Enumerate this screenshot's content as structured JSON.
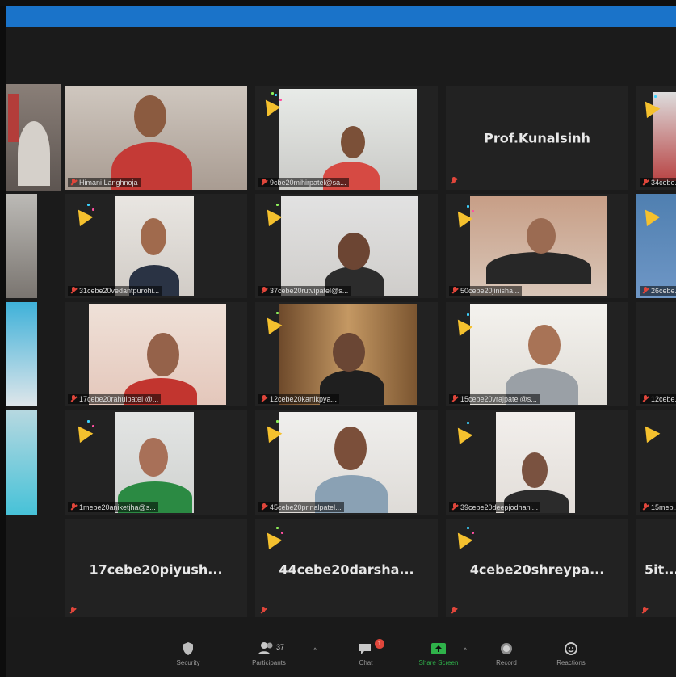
{
  "tiles": [
    {
      "label": "Himani Langhnoja"
    },
    {
      "label": "9cbe20mihirpatel@sa..."
    },
    {
      "label": "Prof.Kunalsinh"
    },
    {
      "label": "34cebe..."
    },
    {
      "label": "31cebe20vedantpurohi..."
    },
    {
      "label": "37cebe20rutvipatel@s..."
    },
    {
      "label": "50cebe20jinisha..."
    },
    {
      "label": "26cebe..."
    },
    {
      "label": "17cebe20rahulpatel @..."
    },
    {
      "label": "12cebe20kartikpya..."
    },
    {
      "label": "15cebe20vrajpatel@s..."
    },
    {
      "label": "12cebe..."
    },
    {
      "label": "1mebe20aniketjha@s..."
    },
    {
      "label": "45cebe20prinalpatel..."
    },
    {
      "label": "39cebe20deepjodhani..."
    },
    {
      "label": "15meb..."
    },
    {
      "label": "17cebe20piyush..."
    },
    {
      "label": "44cebe20darsha..."
    },
    {
      "label": "4cebe20shreypa..."
    },
    {
      "label": "5it..."
    }
  ],
  "toolbar": {
    "security": "Security",
    "participants": "Participants",
    "participants_count": "37",
    "chat": "Chat",
    "chat_badge": "1",
    "share_screen": "Share Screen",
    "record": "Record",
    "reactions": "Reactions"
  },
  "colors": {
    "accent_blue": "#1a73c9",
    "muted_red": "#e0463b",
    "share_green": "#2fb24a",
    "active_speaker": "#b9d36b"
  }
}
